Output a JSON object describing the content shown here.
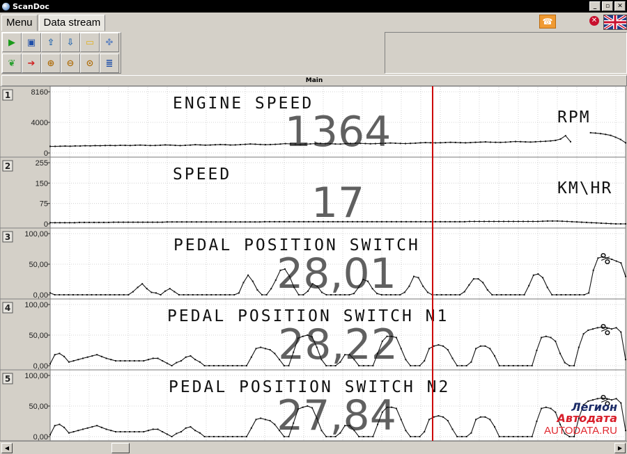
{
  "window": {
    "title": "ScanDoc"
  },
  "menu": {
    "tabs": [
      "Menu",
      "Data stream"
    ]
  },
  "section": {
    "label": "Main"
  },
  "colors": {
    "cursor": "#cc0000",
    "trace": "#111111",
    "grid": "#c8c8c8"
  },
  "toolbar": {
    "row1": [
      "play-icon",
      "save-icon",
      "export-icon",
      "import-icon",
      "open-folder-icon",
      "fan-icon"
    ],
    "row2": [
      "leaf-icon",
      "arrow-right-icon",
      "zoom-in-icon",
      "zoom-out-icon",
      "zoom-fit-icon",
      "list-icon"
    ]
  },
  "watermark": {
    "line1": "Легион",
    "line2": "Автодата",
    "line3": "AUTODATA.RU"
  },
  "chart_data": [
    {
      "type": "line",
      "index": "1",
      "title": "ENGINE SPEED",
      "value": "1364",
      "unit": "RPM",
      "yticks": [
        "8160",
        "4000",
        "0"
      ],
      "ylim": [
        0,
        8160
      ],
      "values": [
        880,
        880,
        900,
        920,
        900,
        940,
        930,
        960,
        950,
        980,
        960,
        990,
        1000,
        980,
        1020,
        1010,
        990,
        1030,
        1050,
        1020,
        990,
        1000,
        1030,
        1080,
        1050,
        1010,
        980,
        1020,
        1050,
        1100,
        1080,
        1040,
        1060,
        1090,
        1120,
        1100,
        1060,
        1080,
        1110,
        1150,
        1200,
        1170,
        1130,
        1100,
        1120,
        1150,
        1190,
        1240,
        1210,
        1180,
        1150,
        1180,
        1210,
        1240,
        1280,
        1250,
        1220,
        1200,
        1190,
        1230,
        1270,
        1300,
        1280,
        1250,
        1220,
        1240,
        1270,
        1300,
        1330,
        1300,
        1270,
        1250,
        1280,
        1310,
        1350,
        1380,
        1360,
        1340,
        1364,
        1390,
        1420,
        1400,
        1370,
        1350,
        1380,
        1420,
        1450,
        1470,
        1440,
        1420,
        1410,
        1440,
        1480,
        1520,
        1500,
        1470,
        1460,
        1490,
        1530,
        1560,
        1600,
        1680,
        1850,
        2300,
        1500,
        null,
        null,
        null,
        2700,
        2650,
        2580,
        2480,
        2350,
        2100,
        1800,
        1350
      ]
    },
    {
      "type": "line",
      "index": "2",
      "title": "SPEED",
      "value": "17",
      "unit": "KM\\HR",
      "yticks": [
        "255",
        "150",
        "75",
        "0"
      ],
      "ylim": [
        0,
        255
      ],
      "values": [
        5,
        5,
        5,
        5,
        5,
        5,
        6,
        6,
        6,
        6,
        6,
        6,
        6,
        7,
        7,
        7,
        7,
        7,
        7,
        7,
        7,
        7,
        7,
        7,
        8,
        8,
        8,
        8,
        8,
        8,
        8,
        8,
        8,
        8,
        8,
        8,
        8,
        8,
        8,
        8,
        8,
        8,
        8,
        8,
        9,
        9,
        9,
        9,
        9,
        9,
        9,
        9,
        9,
        9,
        9,
        9,
        9,
        9,
        9,
        9,
        9,
        9,
        9,
        9,
        9,
        9,
        9,
        9,
        9,
        9,
        9,
        9,
        9,
        9,
        9,
        9,
        9,
        9,
        9,
        9,
        9,
        9,
        9,
        9,
        9,
        9,
        10,
        10,
        10,
        10,
        10,
        10,
        10,
        10,
        10,
        10,
        10,
        10,
        10,
        10,
        10,
        11,
        12,
        12,
        12,
        11,
        10,
        9,
        8,
        7,
        6,
        5,
        4,
        3,
        2,
        1,
        0,
        0,
        0
      ]
    },
    {
      "type": "line",
      "index": "3",
      "title": "PEDAL POSITION SWITCH",
      "value": "28,01",
      "unit": "%",
      "yticks": [
        "100,00",
        "50,00",
        "0,00"
      ],
      "ylim": [
        0,
        100
      ],
      "values": [
        3,
        0,
        0,
        0,
        0,
        0,
        0,
        0,
        0,
        0,
        0,
        0,
        0,
        0,
        0,
        0,
        0,
        0,
        5,
        12,
        18,
        10,
        4,
        3,
        0,
        6,
        10,
        5,
        0,
        0,
        0,
        0,
        0,
        0,
        0,
        0,
        0,
        0,
        0,
        0,
        0,
        3,
        20,
        32,
        22,
        8,
        0,
        0,
        10,
        24,
        40,
        42,
        30,
        12,
        0,
        0,
        6,
        18,
        14,
        4,
        0,
        0,
        0,
        0,
        0,
        0,
        2,
        12,
        25,
        22,
        10,
        2,
        0,
        0,
        0,
        0,
        0,
        4,
        14,
        30,
        28,
        14,
        4,
        0,
        0,
        0,
        0,
        0,
        0,
        0,
        5,
        16,
        26,
        26,
        20,
        8,
        0,
        0,
        0,
        0,
        0,
        0,
        0,
        0,
        15,
        32,
        34,
        28,
        12,
        0,
        0,
        0,
        0,
        0,
        0,
        0,
        0,
        3,
        40,
        60,
        62,
        60,
        58,
        55,
        52,
        30
      ]
    },
    {
      "type": "line",
      "index": "4",
      "title": "PEDAL POSITION SWITCH N1",
      "value": "28,22",
      "unit": "%",
      "yticks": [
        "100,00",
        "50,00",
        "0,00"
      ],
      "ylim": [
        0,
        100
      ],
      "values": [
        3,
        18,
        20,
        15,
        6,
        8,
        10,
        12,
        14,
        16,
        18,
        15,
        12,
        10,
        8,
        8,
        8,
        8,
        8,
        8,
        8,
        10,
        12,
        12,
        8,
        4,
        0,
        5,
        8,
        14,
        16,
        10,
        6,
        0,
        0,
        0,
        0,
        0,
        0,
        0,
        0,
        0,
        0,
        14,
        28,
        30,
        28,
        26,
        20,
        10,
        0,
        0,
        22,
        45,
        48,
        50,
        47,
        30,
        10,
        0,
        0,
        0,
        6,
        18,
        18,
        10,
        0,
        0,
        0,
        0,
        20,
        40,
        48,
        48,
        46,
        28,
        10,
        0,
        0,
        0,
        8,
        28,
        32,
        34,
        32,
        26,
        12,
        0,
        0,
        0,
        6,
        28,
        32,
        32,
        28,
        16,
        0,
        0,
        0,
        0,
        0,
        0,
        0,
        0,
        25,
        46,
        48,
        46,
        40,
        20,
        5,
        0,
        0,
        30,
        52,
        58,
        60,
        62,
        63,
        62,
        60,
        62,
        55,
        10
      ]
    },
    {
      "type": "line",
      "index": "5",
      "title": "PEDAL POSITION SWITCH N2",
      "value": "27,84",
      "unit": "%",
      "yticks": [
        "100,00",
        "50,00",
        "0,00"
      ],
      "ylim": [
        0,
        100
      ],
      "values": [
        3,
        18,
        20,
        15,
        6,
        8,
        10,
        12,
        14,
        16,
        18,
        15,
        12,
        10,
        8,
        8,
        8,
        8,
        8,
        8,
        8,
        10,
        12,
        12,
        8,
        4,
        0,
        5,
        8,
        14,
        16,
        10,
        6,
        0,
        0,
        0,
        0,
        0,
        0,
        0,
        0,
        0,
        0,
        14,
        28,
        30,
        28,
        26,
        20,
        10,
        0,
        0,
        22,
        45,
        48,
        50,
        47,
        30,
        10,
        0,
        0,
        0,
        6,
        18,
        18,
        10,
        0,
        0,
        0,
        0,
        20,
        40,
        48,
        48,
        46,
        28,
        10,
        0,
        0,
        0,
        8,
        28,
        32,
        34,
        32,
        26,
        12,
        0,
        0,
        0,
        6,
        28,
        32,
        32,
        28,
        16,
        0,
        0,
        0,
        0,
        0,
        0,
        0,
        0,
        25,
        46,
        48,
        46,
        40,
        20,
        5,
        0,
        0,
        30,
        52,
        58,
        60,
        62,
        63,
        62,
        60,
        62,
        55,
        10
      ]
    }
  ]
}
